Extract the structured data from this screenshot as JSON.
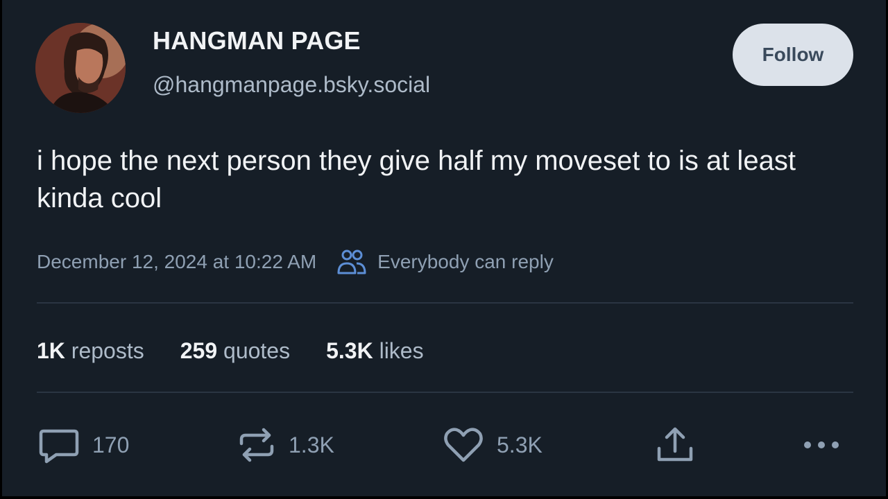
{
  "author": {
    "name": "HANGMAN PAGE",
    "handle": "@hangmanpage.bsky.social",
    "avatar_icon": "profile-photo"
  },
  "follow_button": {
    "label": "Follow"
  },
  "post": {
    "text": "i hope the next person they give half my moveset to is at least kinda cool",
    "timestamp": "December 12, 2024 at 10:22 AM",
    "reply_setting": "Everybody can reply"
  },
  "stats": {
    "reposts": {
      "count": "1K",
      "label": "reposts"
    },
    "quotes": {
      "count": "259",
      "label": "quotes"
    },
    "likes": {
      "count": "5.3K",
      "label": "likes"
    }
  },
  "actions": {
    "reply": {
      "icon": "reply-icon",
      "count": "170"
    },
    "repost": {
      "icon": "repost-icon",
      "count": "1.3K"
    },
    "like": {
      "icon": "heart-icon",
      "count": "5.3K"
    },
    "share": {
      "icon": "share-icon"
    },
    "more": {
      "icon": "more-icon"
    }
  },
  "colors": {
    "background": "#161e27",
    "primary_text": "#f1f3f5",
    "secondary_text": "#aebbc9",
    "muted_text": "#8fa0b3",
    "follow_bg": "#dce2ea"
  }
}
